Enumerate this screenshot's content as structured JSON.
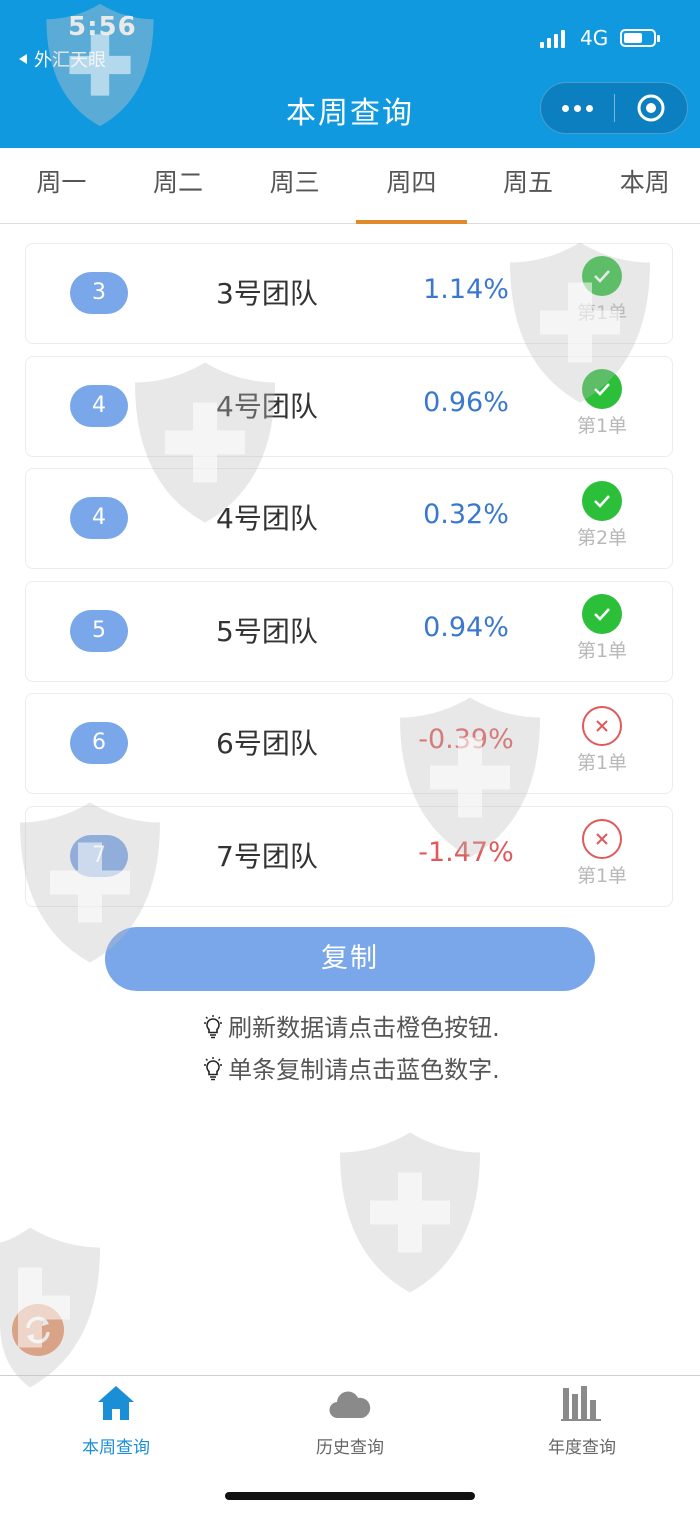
{
  "status_bar": {
    "time": "5:56",
    "back_app": "外汇天眼",
    "network": "4G"
  },
  "title": "本周查询",
  "tabs": [
    "周一",
    "周二",
    "周三",
    "周四",
    "周五",
    "本周"
  ],
  "active_tab": 3,
  "rows": [
    {
      "rank": "3",
      "team": "3号团队",
      "pct": "1.14%",
      "positive": true,
      "order": "第1单"
    },
    {
      "rank": "4",
      "team": "4号团队",
      "pct": "0.96%",
      "positive": true,
      "order": "第1单"
    },
    {
      "rank": "4",
      "team": "4号团队",
      "pct": "0.32%",
      "positive": true,
      "order": "第2单"
    },
    {
      "rank": "5",
      "team": "5号团队",
      "pct": "0.94%",
      "positive": true,
      "order": "第1单"
    },
    {
      "rank": "6",
      "team": "6号团队",
      "pct": "-0.39%",
      "positive": false,
      "order": "第1单"
    },
    {
      "rank": "7",
      "team": "7号团队",
      "pct": "-1.47%",
      "positive": false,
      "order": "第1单"
    }
  ],
  "copy_button": "复制",
  "tips": [
    "刷新数据请点击橙色按钮.",
    "单条复制请点击蓝色数字."
  ],
  "bottom_nav": [
    {
      "label": "本周查询",
      "icon": "home-icon",
      "active": true
    },
    {
      "label": "历史查询",
      "icon": "cloud-icon",
      "active": false
    },
    {
      "label": "年度查询",
      "icon": "bar-chart-icon",
      "active": false
    }
  ],
  "colors": {
    "header": "#1199e0",
    "positive": "#3a78d0",
    "negative": "#e05a5a",
    "badge": "#7aa7ea",
    "tab_active": "#e08a2b",
    "nav_active": "#1a8fd6",
    "nav_inactive": "#666666"
  }
}
